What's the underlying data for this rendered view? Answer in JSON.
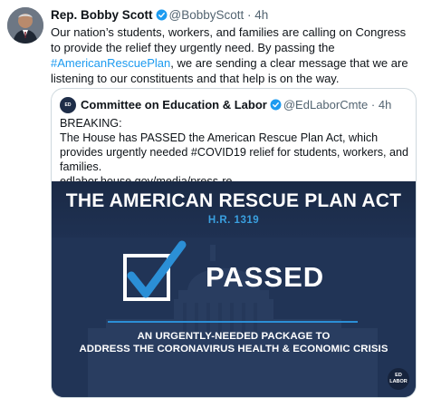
{
  "tweet": {
    "author_name": "Rep. Bobby Scott",
    "handle": "@BobbyScott",
    "separator": "·",
    "time": "4h",
    "text_part1": "Our nation’s students, workers, and families are calling on Congress to provide the relief they urgently need.  By passing the ",
    "hashtag": "#AmericanRescuePlan",
    "text_part2": ", we are sending a clear message that we are listening to our constituents and that help is on the way."
  },
  "quoted_tweet": {
    "author_name": "Committee on Education & Labor",
    "handle": "@EdLaborCmte",
    "separator": "·",
    "time": "4h",
    "avatar_text": "ED LABOR",
    "line1": "BREAKING:",
    "line2": "The House has PASSED the American Rescue Plan Act, which provides urgently needed #COVID19 relief for students, workers, and families.",
    "line3": "edlabor.house.gov/media/press-re..."
  },
  "media": {
    "title": "THE AMERICAN RESCUE PLAN ACT",
    "subtitle": "H.R. 1319",
    "status": "PASSED",
    "tagline_line1": "AN URGENTLY-NEEDED PACKAGE TO",
    "tagline_line2": "ADDRESS THE CORONAVIRUS HEALTH & ECONOMIC CRISIS",
    "logo_line1": "ED",
    "logo_line2": "LABOR"
  },
  "colors": {
    "link": "#1d9bf0",
    "verified": "#1d9bf0",
    "media_bg": "#1e2f4f",
    "accent_blue": "#2b8fd6"
  }
}
